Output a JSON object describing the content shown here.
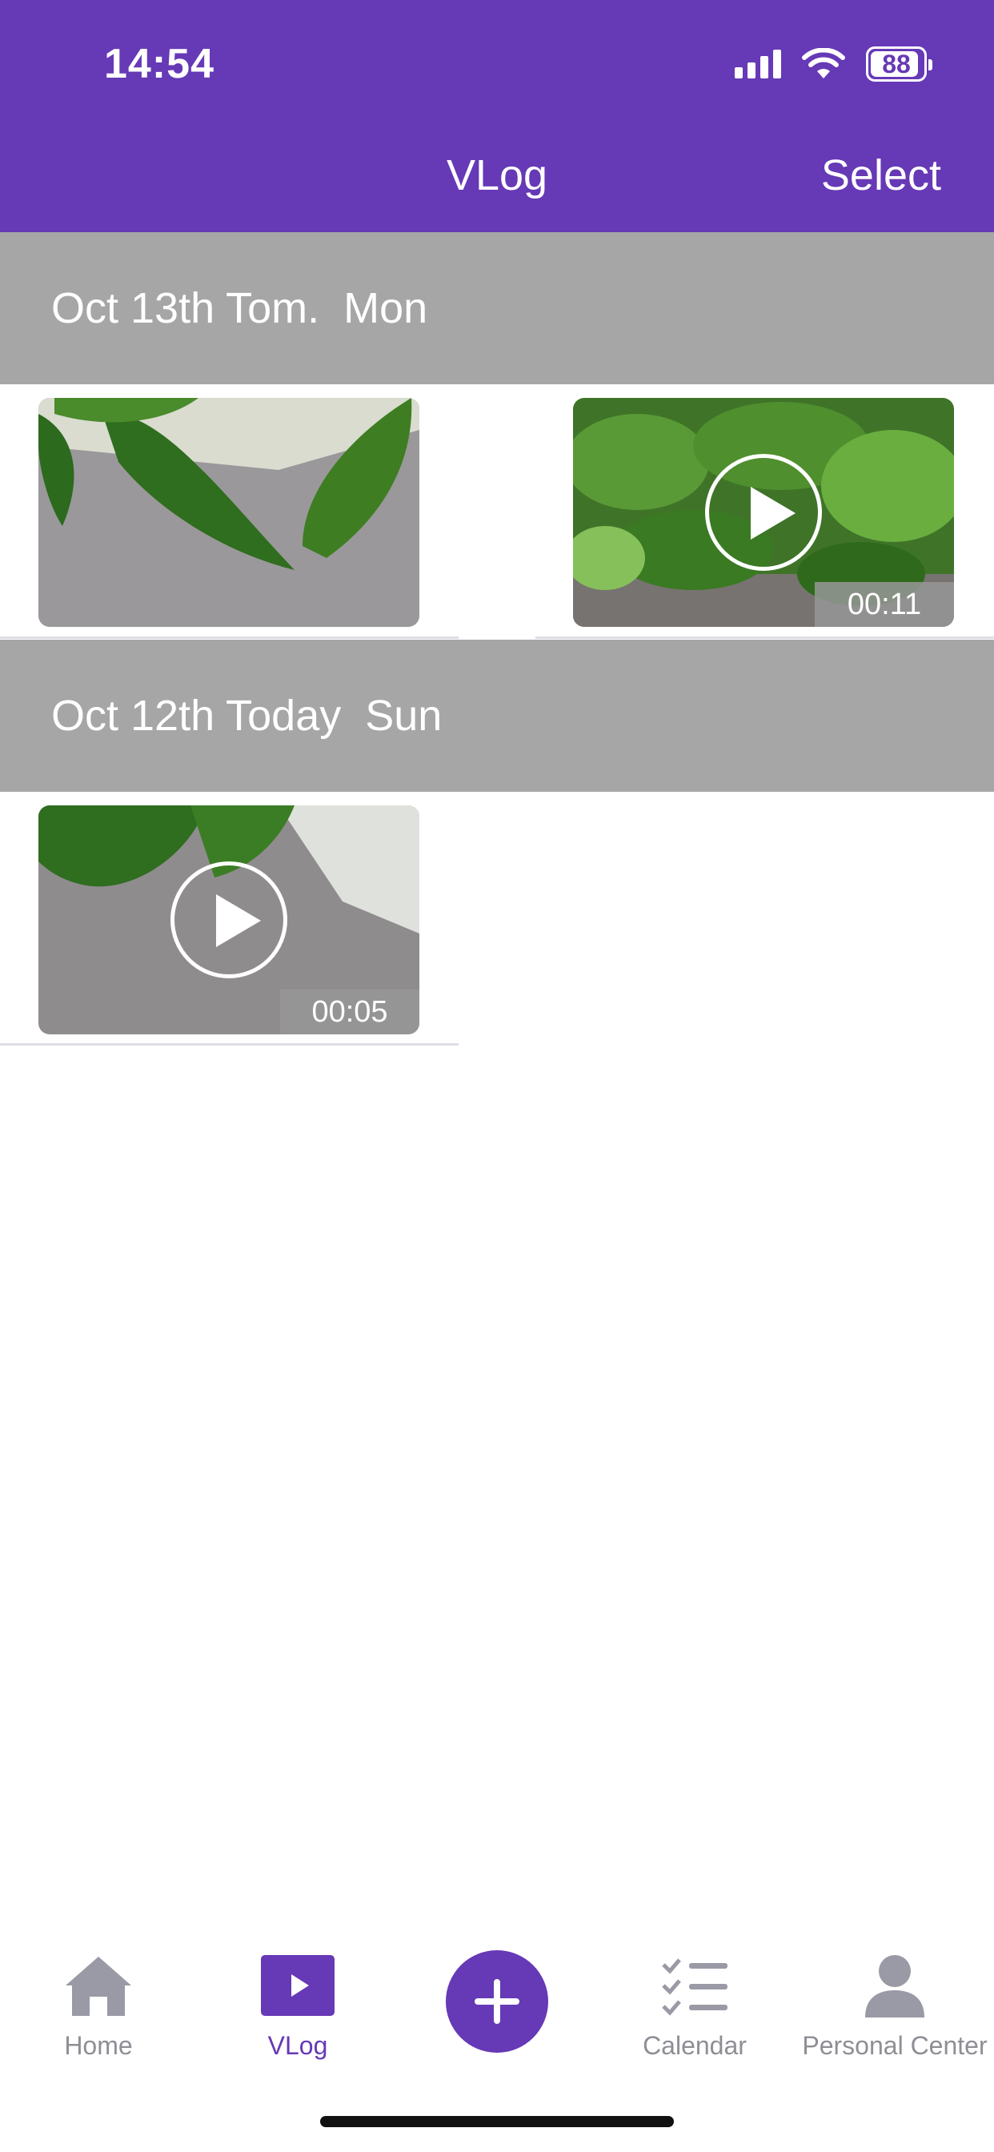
{
  "status_bar": {
    "time": "14:54",
    "battery": "88"
  },
  "nav": {
    "title": "VLog",
    "select_label": "Select"
  },
  "sections": [
    {
      "date": "Oct 13th Tom.",
      "day": "Mon",
      "items": [
        {
          "type": "photo"
        },
        {
          "type": "video",
          "duration": "00:11"
        }
      ]
    },
    {
      "date": "Oct 12th Today",
      "day": "Sun",
      "items": [
        {
          "type": "video",
          "duration": "00:05"
        }
      ]
    }
  ],
  "tabs": [
    {
      "label": "Home",
      "icon": "home-icon"
    },
    {
      "label": "VLog",
      "icon": "vlog-play-icon",
      "active": true
    },
    {
      "label": "",
      "icon": "plus-icon"
    },
    {
      "label": "Calendar",
      "icon": "checklist-icon"
    },
    {
      "label": "Personal Center",
      "icon": "person-icon"
    }
  ],
  "colors": {
    "accent": "#6639B6",
    "section_header": "#A6A6A6",
    "tab_inactive": "#8E8E96"
  }
}
